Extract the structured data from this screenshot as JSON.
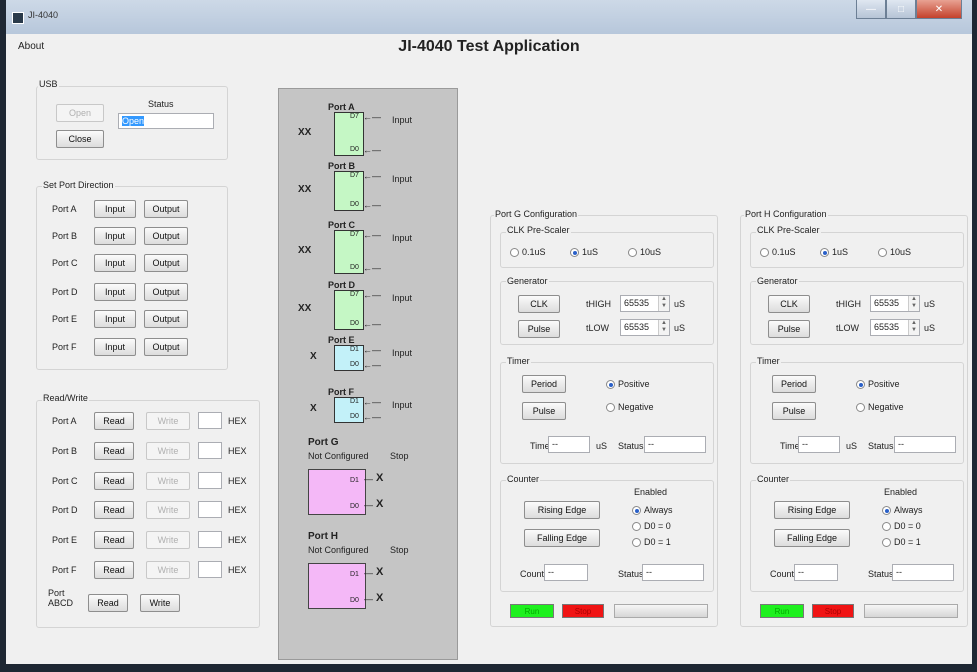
{
  "window": {
    "title": "JI-4040",
    "app_title": "JI-4040 Test Application",
    "menu_about": "About"
  },
  "usb": {
    "group": "USB",
    "open": "Open",
    "close": "Close",
    "status_label": "Status",
    "status_value": "Open"
  },
  "direction": {
    "group": "Set Port Direction",
    "input": "Input",
    "output": "Output",
    "ports": [
      "Port A",
      "Port B",
      "Port C",
      "Port D",
      "Port E",
      "Port F"
    ]
  },
  "readwrite": {
    "group": "Read/Write",
    "read": "Read",
    "write": "Write",
    "hex": "HEX",
    "ports": [
      "Port A",
      "Port B",
      "Port C",
      "Port D",
      "Port E",
      "Port F"
    ],
    "abcd_line1": "Port",
    "abcd_line2": "ABCD"
  },
  "diagram": {
    "ports": [
      {
        "name": "Port A",
        "value": "XX",
        "dir": "Input",
        "hi": "D7",
        "lo": "D0"
      },
      {
        "name": "Port B",
        "value": "XX",
        "dir": "Input",
        "hi": "D7",
        "lo": "D0"
      },
      {
        "name": "Port C",
        "value": "XX",
        "dir": "Input",
        "hi": "D7",
        "lo": "D0"
      },
      {
        "name": "Port D",
        "value": "XX",
        "dir": "Input",
        "hi": "D7",
        "lo": "D0"
      },
      {
        "name": "Port E",
        "value": "X",
        "dir": "Input",
        "hi": "D1",
        "lo": "D0"
      },
      {
        "name": "Port F",
        "value": "X",
        "dir": "Input",
        "hi": "D1",
        "lo": "D0"
      }
    ],
    "gh": [
      {
        "name": "Port G",
        "state": "Not Configured",
        "stop": "Stop",
        "hi": "D1",
        "lo": "D0",
        "x1": "X",
        "x2": "X"
      },
      {
        "name": "Port H",
        "state": "Not Configured",
        "stop": "Stop",
        "hi": "D1",
        "lo": "D0",
        "x1": "X",
        "x2": "X"
      }
    ]
  },
  "config": [
    {
      "title": "Port G Configuration",
      "clk_group": "CLK Pre-Scaler",
      "prescalers": [
        "0.1uS",
        "1uS",
        "10uS"
      ],
      "prescaler_selected": 1,
      "gen_group": "Generator",
      "clk": "CLK",
      "pulse": "Pulse",
      "thigh": "tHIGH",
      "tlow": "tLOW",
      "thigh_val": "65535",
      "tlow_val": "65535",
      "unit": "uS",
      "timer_group": "Timer",
      "period": "Period",
      "timer_pulse": "Pulse",
      "positive": "Positive",
      "negative": "Negative",
      "time_label": "Time",
      "time_val": "--",
      "time_unit": "uS",
      "status_label": "Status",
      "status_val": "--",
      "counter_group": "Counter",
      "rising": "Rising Edge",
      "falling": "Falling Edge",
      "enabled": "Enabled",
      "always": "Always",
      "d0_0": "D0 = 0",
      "d0_1": "D0 = 1",
      "count_label": "Count",
      "count_val": "--",
      "cstatus_label": "Status",
      "cstatus_val": "--",
      "run": "Run",
      "stop": "Stop"
    },
    {
      "title": "Port H Configuration",
      "clk_group": "CLK Pre-Scaler",
      "prescalers": [
        "0.1uS",
        "1uS",
        "10uS"
      ],
      "prescaler_selected": 1,
      "gen_group": "Generator",
      "clk": "CLK",
      "pulse": "Pulse",
      "thigh": "tHIGH",
      "tlow": "tLOW",
      "thigh_val": "65535",
      "tlow_val": "65535",
      "unit": "uS",
      "timer_group": "Timer",
      "period": "Period",
      "timer_pulse": "Pulse",
      "positive": "Positive",
      "negative": "Negative",
      "time_label": "Time",
      "time_val": "--",
      "time_unit": "uS",
      "status_label": "Status",
      "status_val": "--",
      "counter_group": "Counter",
      "rising": "Rising Edge",
      "falling": "Falling Edge",
      "enabled": "Enabled",
      "always": "Always",
      "d0_0": "D0 = 0",
      "d0_1": "D0 = 1",
      "count_label": "Count",
      "count_val": "--",
      "cstatus_label": "Status",
      "cstatus_val": "--",
      "run": "Run",
      "stop": "Stop"
    }
  ]
}
